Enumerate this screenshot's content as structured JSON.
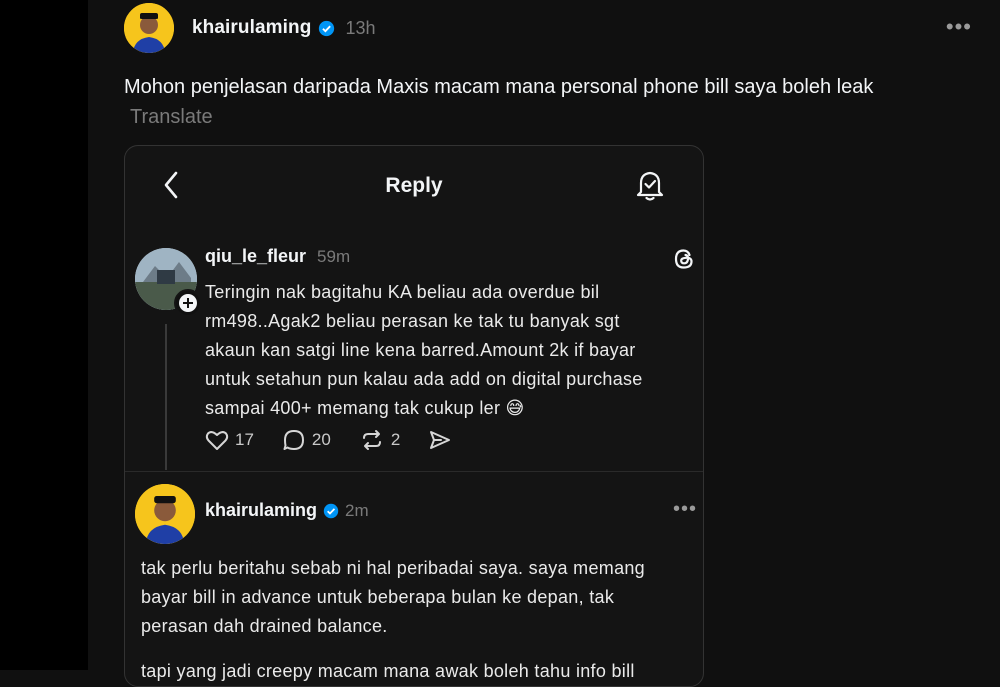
{
  "post": {
    "username": "khairulaming",
    "time": "13h",
    "text": "Mohon penjelasan daripada Maxis macam mana personal phone bill saya boleh leak",
    "translate_label": "Translate",
    "more_label": "•••"
  },
  "embedded": {
    "title": "Reply",
    "reply1": {
      "username": "qiu_le_fleur",
      "time": "59m",
      "lines": [
        "Teringin nak bagitahu KA beliau ada overdue bil",
        "rm498..Agak2 beliau perasan ke tak tu banyak sgt",
        "akaun kan satgi line kena barred.Amount 2k if bayar",
        "untuk setahun pun kalau ada add on digital purchase",
        "sampai 400+ memang tak cukup ler 😅"
      ],
      "likes": "17",
      "comments": "20",
      "reposts": "2"
    },
    "reply2": {
      "username": "khairulaming",
      "time": "2m",
      "more_label": "•••",
      "paragraph1": [
        "tak perlu beritahu sebab ni hal peribadai saya. saya memang",
        "bayar bill in advance untuk beberapa bulan ke depan, tak",
        "perasan dah drained balance."
      ],
      "paragraph2": [
        "tapi yang jadi creepy macam mana awak boleh tahu info bill"
      ]
    }
  },
  "icons": {
    "verified": "verified-badge-icon",
    "back": "chevron-left-icon",
    "notify": "bell-check-icon",
    "threads": "threads-logo-icon",
    "like": "heart-icon",
    "comment": "comment-icon",
    "repost": "repost-icon",
    "share": "send-icon",
    "follow": "plus-icon"
  },
  "colors": {
    "background": "#101010",
    "verified_blue": "#0095f6",
    "avatar_yellow": "#f6c51c"
  }
}
